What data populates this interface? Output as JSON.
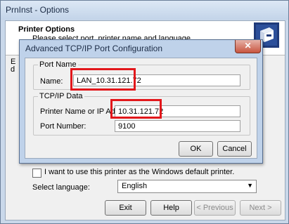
{
  "window": {
    "title": "PrnInst - Options"
  },
  "header": {
    "title": "Printer Options",
    "subtitle": "Please select port, printer name and language."
  },
  "background": {
    "partial_text_1": "E",
    "partial_text_2": "d"
  },
  "default_printer": {
    "label": "I want to use this printer as the Windows default printer.",
    "checked": false
  },
  "language": {
    "label": "Select language:",
    "value": "English"
  },
  "footer": {
    "exit": "Exit",
    "help": "Help",
    "previous": "< Previous",
    "next": "Next >"
  },
  "dialog": {
    "title": "Advanced TCP/IP Port Configuration",
    "close_glyph": "✕",
    "port_name": {
      "group": "Port Name",
      "name_label": "Name:",
      "name_value": "LAN_10.31.121.72"
    },
    "tcpip": {
      "group": "TCP/IP Data",
      "printer_label": "Printer Name or IP Address:",
      "printer_value": "10.31.121.72",
      "port_label": "Port Number:",
      "port_value": "9100"
    },
    "ok": "OK",
    "cancel": "Cancel"
  },
  "icons": {
    "header": "printer-setup-icon",
    "close": "close-icon",
    "dropdown": "chevron-down-icon"
  },
  "colors": {
    "highlight": "#e2171b"
  }
}
